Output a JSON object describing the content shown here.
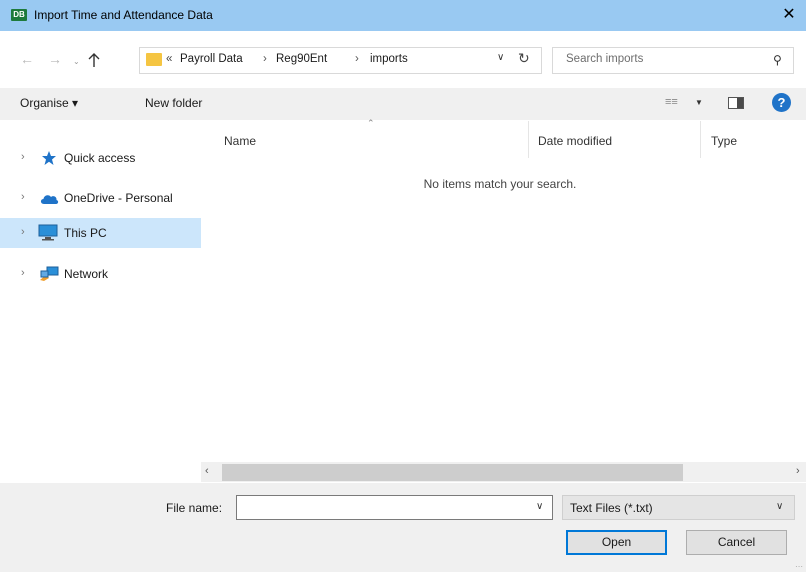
{
  "window": {
    "title": "Import Time and Attendance Data",
    "app_icon_text": "DB",
    "close_glyph": "✕"
  },
  "address_bar": {
    "overflow": "«",
    "crumbs": [
      "Payroll Data",
      "Reg90Ent",
      "imports"
    ],
    "separator": "›",
    "dropdown_glyph": "∨",
    "refresh_glyph": "↻"
  },
  "search": {
    "placeholder": "Search imports",
    "value": "",
    "icon": "search-icon"
  },
  "toolbar": {
    "organise_label": "Organise ▾",
    "new_folder_label": "New folder"
  },
  "nav_pane": {
    "items": [
      {
        "label": "Quick access",
        "icon": "star-icon",
        "icon_color": "#1f73c8"
      },
      {
        "label": "OneDrive - Personal",
        "icon": "cloud-icon",
        "icon_color": "#1f73c8"
      },
      {
        "label": "This PC",
        "icon": "monitor-icon",
        "icon_color": "#2a8fd8",
        "selected": true
      },
      {
        "label": "Network",
        "icon": "network-icon",
        "icon_color": "#2a8fd8"
      }
    ]
  },
  "file_list": {
    "columns": [
      "Name",
      "Date modified",
      "Type"
    ],
    "empty_message": "No items match your search."
  },
  "bottom": {
    "file_name_label": "File name:",
    "file_name_value": "",
    "file_type": "Text Files (*.txt)",
    "open_label": "Open",
    "cancel_label": "Cancel"
  },
  "colors": {
    "titlebar": "#99c9f2",
    "selection": "#cce6fb",
    "accent": "#0078d7"
  }
}
